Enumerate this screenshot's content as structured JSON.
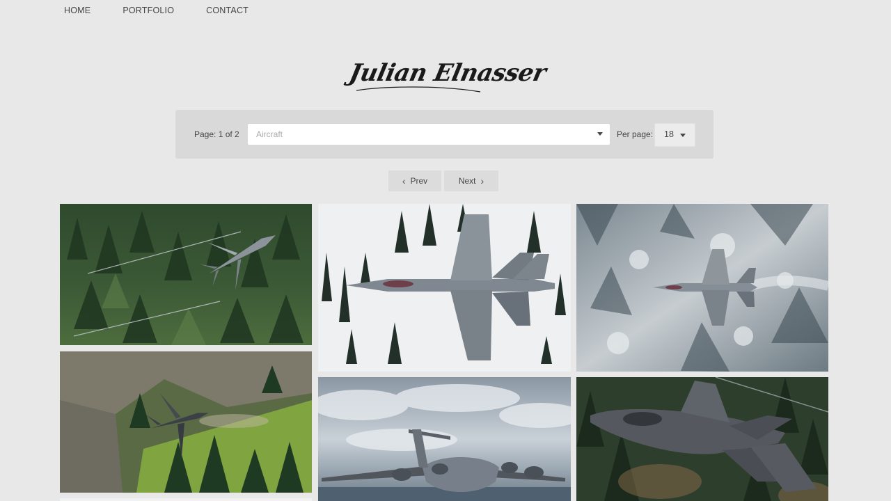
{
  "nav": {
    "items": [
      {
        "label": "HOME"
      },
      {
        "label": "PORTFOLIO"
      },
      {
        "label": "CONTACT"
      }
    ]
  },
  "logo": {
    "text": "Julian Elnasser"
  },
  "filters": {
    "page_info": "Page: 1 of 2",
    "category_placeholder": "Aircraft",
    "per_page_label": "Per page:",
    "per_page_value": "18"
  },
  "pager": {
    "prev_label": "Prev",
    "next_label": "Next"
  },
  "colors": {
    "background": "#e8e8e8",
    "panel": "#d9d9d9",
    "button": "#dcdcdc"
  }
}
